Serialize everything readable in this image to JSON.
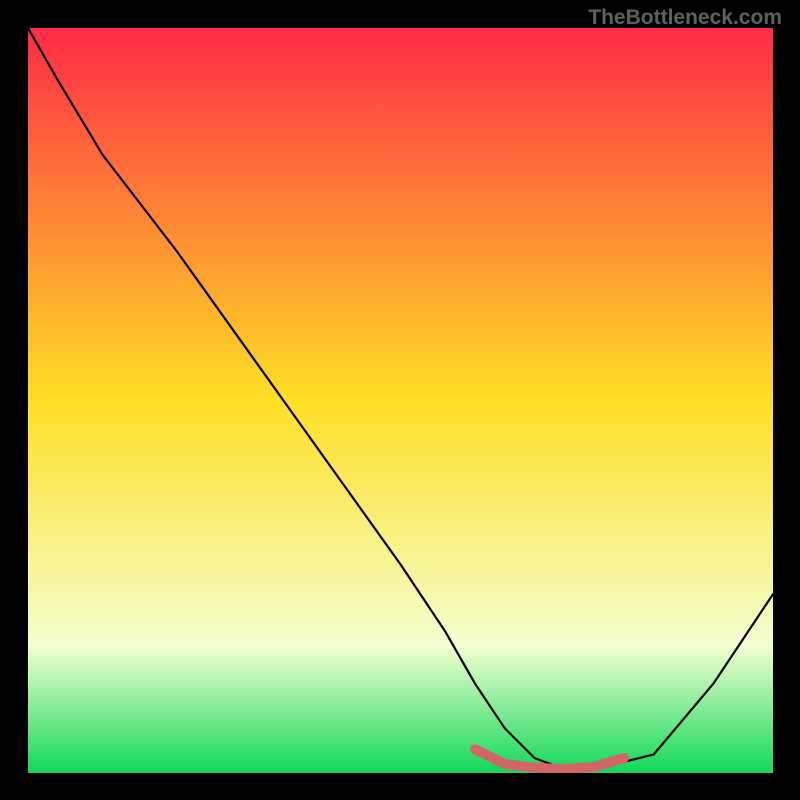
{
  "watermark": "TheBottleneck.com",
  "colors": {
    "page_bg": "#000000",
    "grad_top": "#ff2b46",
    "grad_mid": "#ffdf24",
    "grad_low": "#f3ffd0",
    "grad_bottom": "#11d85a",
    "curve": "#000000",
    "band": "#d26566"
  },
  "chart_data": {
    "type": "line",
    "title": "",
    "xlabel": "",
    "ylabel": "",
    "xlim": [
      0,
      100
    ],
    "ylim": [
      0,
      100
    ],
    "grid": false,
    "legend": false,
    "series": [
      {
        "name": "bottleneck-curve",
        "x": [
          0,
          4,
          10,
          20,
          30,
          40,
          50,
          56,
          60,
          64,
          68,
          72,
          76,
          84,
          92,
          100
        ],
        "y": [
          100,
          93,
          83,
          70,
          56,
          42,
          28,
          19,
          12,
          6,
          2,
          0.5,
          0.5,
          2.5,
          12,
          24
        ]
      },
      {
        "name": "optimal-band",
        "x": [
          60,
          64,
          68,
          72,
          76,
          80
        ],
        "y": [
          3.2,
          1.2,
          0.7,
          0.5,
          0.8,
          2.0
        ]
      }
    ],
    "annotations": []
  }
}
